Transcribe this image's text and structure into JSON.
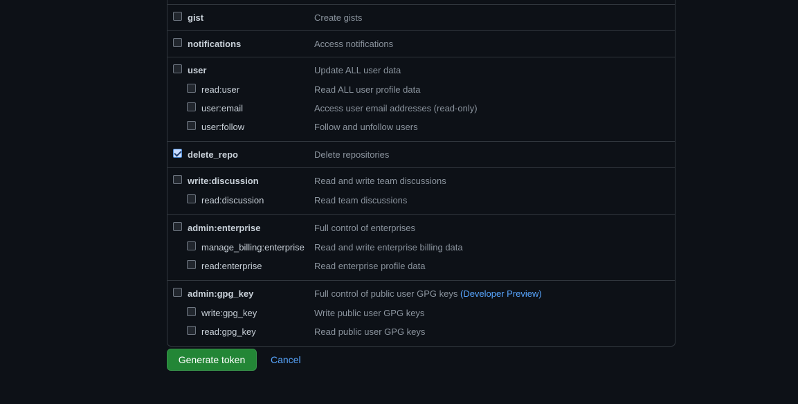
{
  "scopes": [
    {
      "name": "gist",
      "description": "Create gists",
      "checked": false,
      "children": []
    },
    {
      "name": "notifications",
      "description": "Access notifications",
      "checked": false,
      "children": []
    },
    {
      "name": "user",
      "description": "Update ALL user data",
      "checked": false,
      "children": [
        {
          "name": "read:user",
          "description": "Read ALL user profile data",
          "checked": false
        },
        {
          "name": "user:email",
          "description": "Access user email addresses (read-only)",
          "checked": false
        },
        {
          "name": "user:follow",
          "description": "Follow and unfollow users",
          "checked": false
        }
      ]
    },
    {
      "name": "delete_repo",
      "description": "Delete repositories",
      "checked": true,
      "children": []
    },
    {
      "name": "write:discussion",
      "description": "Read and write team discussions",
      "checked": false,
      "children": [
        {
          "name": "read:discussion",
          "description": "Read team discussions",
          "checked": false
        }
      ]
    },
    {
      "name": "admin:enterprise",
      "description": "Full control of enterprises",
      "checked": false,
      "children": [
        {
          "name": "manage_billing:enterprise",
          "description": "Read and write enterprise billing data",
          "checked": false
        },
        {
          "name": "read:enterprise",
          "description": "Read enterprise profile data",
          "checked": false
        }
      ]
    },
    {
      "name": "admin:gpg_key",
      "description": "Full control of public user GPG keys",
      "link": "(Developer Preview)",
      "checked": false,
      "children": [
        {
          "name": "write:gpg_key",
          "description": "Write public user GPG keys",
          "checked": false
        },
        {
          "name": "read:gpg_key",
          "description": "Read public user GPG keys",
          "checked": false
        }
      ]
    }
  ],
  "actions": {
    "generate_label": "Generate token",
    "cancel_label": "Cancel"
  }
}
